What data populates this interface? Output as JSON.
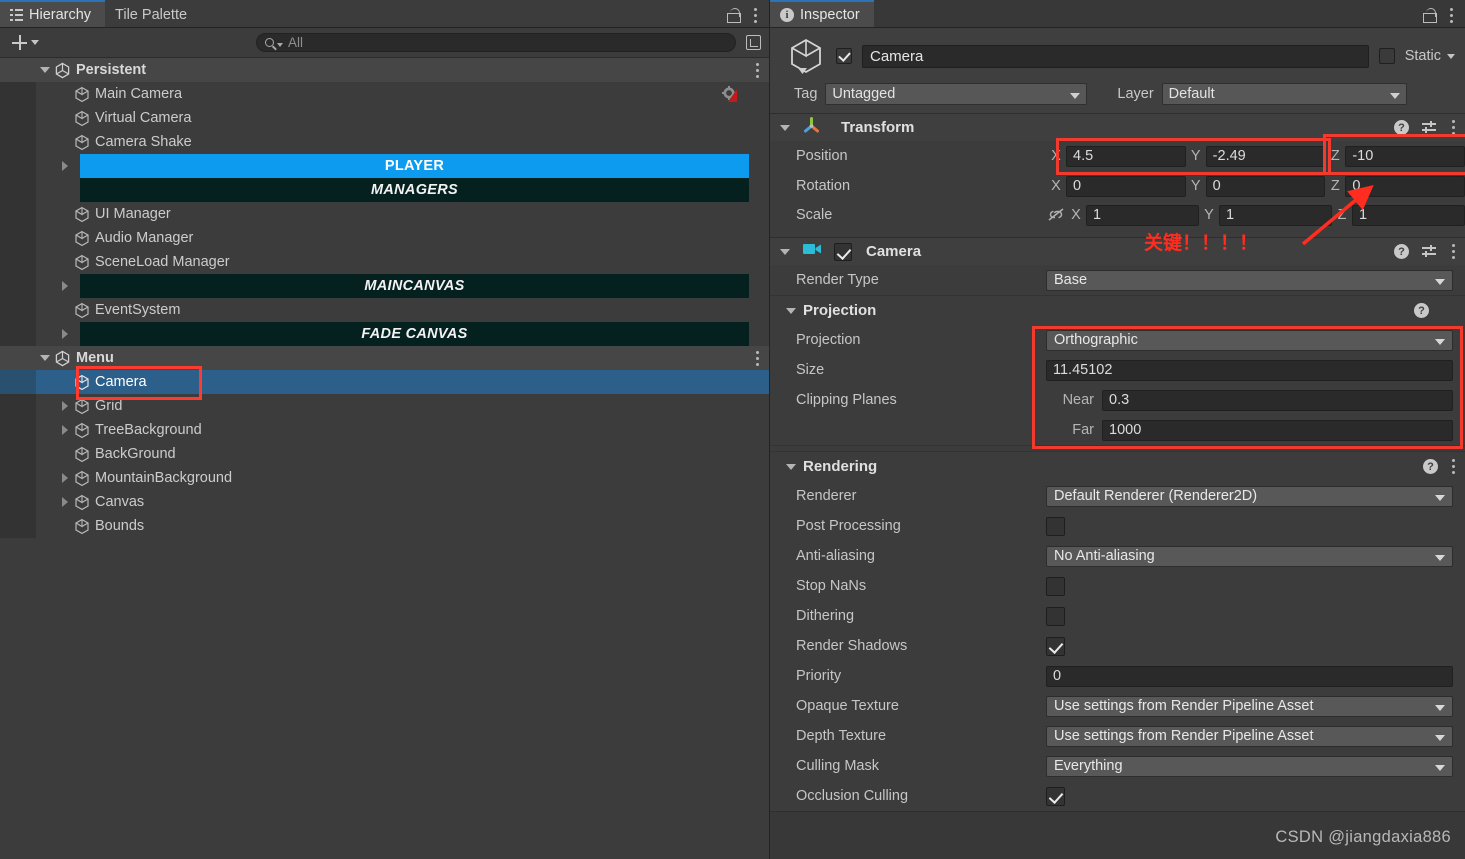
{
  "hierarchy": {
    "tabs": [
      {
        "label": "Hierarchy",
        "active": true,
        "icon": "hierarchy-icon"
      },
      {
        "label": "Tile Palette",
        "active": false,
        "icon": null
      }
    ],
    "toolbar": {
      "add_label": "+",
      "search_placeholder": "All",
      "search_value": ""
    },
    "rows": [
      {
        "type": "scene",
        "label": "Persistent",
        "indent": 0,
        "expanded": true,
        "icon": "unity-scene-icon"
      },
      {
        "type": "object",
        "label": "Main Camera",
        "indent": 2,
        "icon": "gameobject-cube-icon",
        "badge": "audio-listener-warning-icon"
      },
      {
        "type": "object",
        "label": "Virtual Camera",
        "indent": 2,
        "icon": "gameobject-cube-icon"
      },
      {
        "type": "object",
        "label": "Camera Shake",
        "indent": 2,
        "icon": "gameobject-cube-icon"
      },
      {
        "type": "band",
        "label": "PLAYER",
        "indent": 1,
        "expandable": true,
        "style": "player"
      },
      {
        "type": "band",
        "label": "MANAGERS",
        "indent": 2,
        "expandable": false,
        "style": "dark"
      },
      {
        "type": "object",
        "label": "UI Manager",
        "indent": 2,
        "icon": "gameobject-cube-icon"
      },
      {
        "type": "object",
        "label": "Audio Manager",
        "indent": 2,
        "icon": "gameobject-cube-icon"
      },
      {
        "type": "object",
        "label": "SceneLoad Manager",
        "indent": 2,
        "icon": "gameobject-cube-icon"
      },
      {
        "type": "band",
        "label": "MAINCANVAS",
        "indent": 1,
        "expandable": true,
        "style": "dark"
      },
      {
        "type": "object",
        "label": "EventSystem",
        "indent": 2,
        "icon": "gameobject-cube-icon"
      },
      {
        "type": "band",
        "label": "FADE CANVAS",
        "indent": 1,
        "expandable": true,
        "style": "dark"
      },
      {
        "type": "scene",
        "label": "Menu",
        "indent": 0,
        "expanded": true,
        "icon": "unity-scene-icon"
      },
      {
        "type": "object",
        "label": "Camera",
        "indent": 2,
        "icon": "gameobject-cube-icon",
        "selected": true,
        "highlighted": true
      },
      {
        "type": "object",
        "label": "Grid",
        "indent": 1,
        "expandable": true,
        "icon": "gameobject-cube-icon"
      },
      {
        "type": "object",
        "label": "TreeBackground",
        "indent": 1,
        "expandable": true,
        "icon": "gameobject-cube-icon"
      },
      {
        "type": "object",
        "label": "BackGround",
        "indent": 2,
        "icon": "gameobject-cube-icon"
      },
      {
        "type": "object",
        "label": "MountainBackground",
        "indent": 1,
        "expandable": true,
        "icon": "gameobject-cube-icon"
      },
      {
        "type": "object",
        "label": "Canvas",
        "indent": 1,
        "expandable": true,
        "icon": "gameobject-cube-icon"
      },
      {
        "type": "object",
        "label": "Bounds",
        "indent": 2,
        "icon": "gameobject-cube-icon"
      }
    ]
  },
  "inspector": {
    "tabs": [
      {
        "label": "Inspector",
        "active": true,
        "icon": "info-icon"
      }
    ],
    "gameobject": {
      "enabled": true,
      "name": "Camera",
      "static_label": "Static",
      "static_checked": false,
      "tag_label": "Tag",
      "tag_value": "Untagged",
      "layer_label": "Layer",
      "layer_value": "Default"
    },
    "transform": {
      "title": "Transform",
      "expanded": true,
      "rows": [
        {
          "label": "Position",
          "x": "4.5",
          "y": "-2.49",
          "z": "-10"
        },
        {
          "label": "Rotation",
          "x": "0",
          "y": "0",
          "z": "0"
        },
        {
          "label": "Scale",
          "x": "1",
          "y": "1",
          "z": "1",
          "link_icon": "unlinked-scale-icon"
        }
      ],
      "axis_labels": [
        "X",
        "Y",
        "Z"
      ]
    },
    "camera": {
      "title": "Camera",
      "enabled": true,
      "render_type_label": "Render Type",
      "render_type_value": "Base",
      "projection_section": {
        "title": "Projection",
        "projection_label": "Projection",
        "projection_value": "Orthographic",
        "size_label": "Size",
        "size_value": "11.45102",
        "clipping_label": "Clipping Planes",
        "near_label": "Near",
        "near_value": "0.3",
        "far_label": "Far",
        "far_value": "1000"
      },
      "rendering_section": {
        "title": "Rendering",
        "fields": [
          {
            "label": "Renderer",
            "type": "dropdown",
            "value": "Default Renderer (Renderer2D)"
          },
          {
            "label": "Post Processing",
            "type": "checkbox",
            "checked": false
          },
          {
            "label": "Anti-aliasing",
            "type": "dropdown",
            "value": "No Anti-aliasing"
          },
          {
            "label": "Stop NaNs",
            "type": "checkbox",
            "checked": false
          },
          {
            "label": "Dithering",
            "type": "checkbox",
            "checked": false
          },
          {
            "label": "Render Shadows",
            "type": "checkbox",
            "checked": true
          },
          {
            "label": "Priority",
            "type": "text",
            "value": "0"
          },
          {
            "label": "Opaque Texture",
            "type": "dropdown",
            "value": "Use settings from Render Pipeline Asset"
          },
          {
            "label": "Depth Texture",
            "type": "dropdown",
            "value": "Use settings from Render Pipeline Asset"
          },
          {
            "label": "Culling Mask",
            "type": "dropdown",
            "value": "Everything"
          },
          {
            "label": "Occlusion Culling",
            "type": "checkbox",
            "checked": true
          }
        ]
      }
    }
  },
  "annotations": {
    "key_text": "关键！！！！",
    "watermark": "CSDN @jiangdaxia886",
    "highlight_color": "#ff3b30"
  }
}
